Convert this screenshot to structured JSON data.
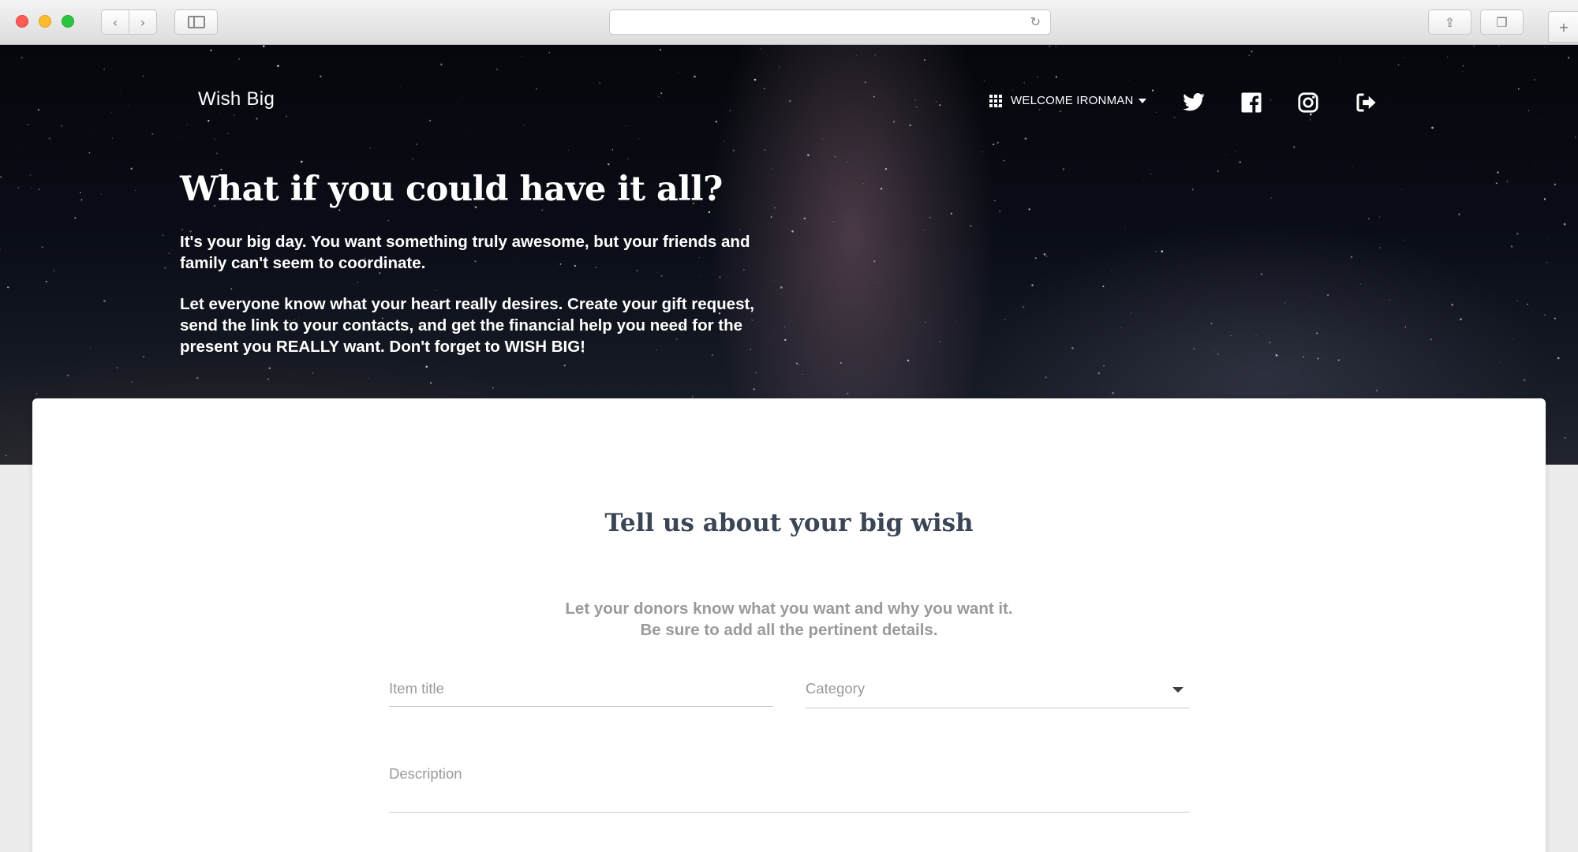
{
  "browser": {
    "url": "",
    "back_glyph": "‹",
    "forward_glyph": "›",
    "reload_glyph": "↻",
    "new_tab_glyph": "+",
    "share_glyph": "⇪",
    "tabs_glyph": "❐"
  },
  "nav": {
    "brand": "Wish Big",
    "user_menu_label": "WELCOME IRONMAN",
    "icons": [
      "apps-grid-icon",
      "chevron-down-icon",
      "twitter-icon",
      "facebook-icon",
      "instagram-icon",
      "logout-icon"
    ]
  },
  "hero": {
    "title": "What if you could have it all?",
    "paragraph1": "It's your big day. You want something truly awesome, but your friends and family can't seem to coordinate.",
    "paragraph2": "Let everyone know what your heart really desires. Create your gift request, send the link to your contacts, and get the financial help you need for the present you REALLY want. Don't forget to WISH BIG!"
  },
  "form": {
    "title": "Tell us about your big wish",
    "subtitle_line1": "Let your donors know what you want and why you want it.",
    "subtitle_line2": "Be sure to add all the pertinent details.",
    "item_title_placeholder": "Item title",
    "category_placeholder": "Category",
    "description_placeholder": "Description"
  },
  "colors": {
    "heading": "#3a4556",
    "muted_text": "#9a9a9a",
    "hero_background": "#0a0d16",
    "card_background": "#ffffff"
  }
}
